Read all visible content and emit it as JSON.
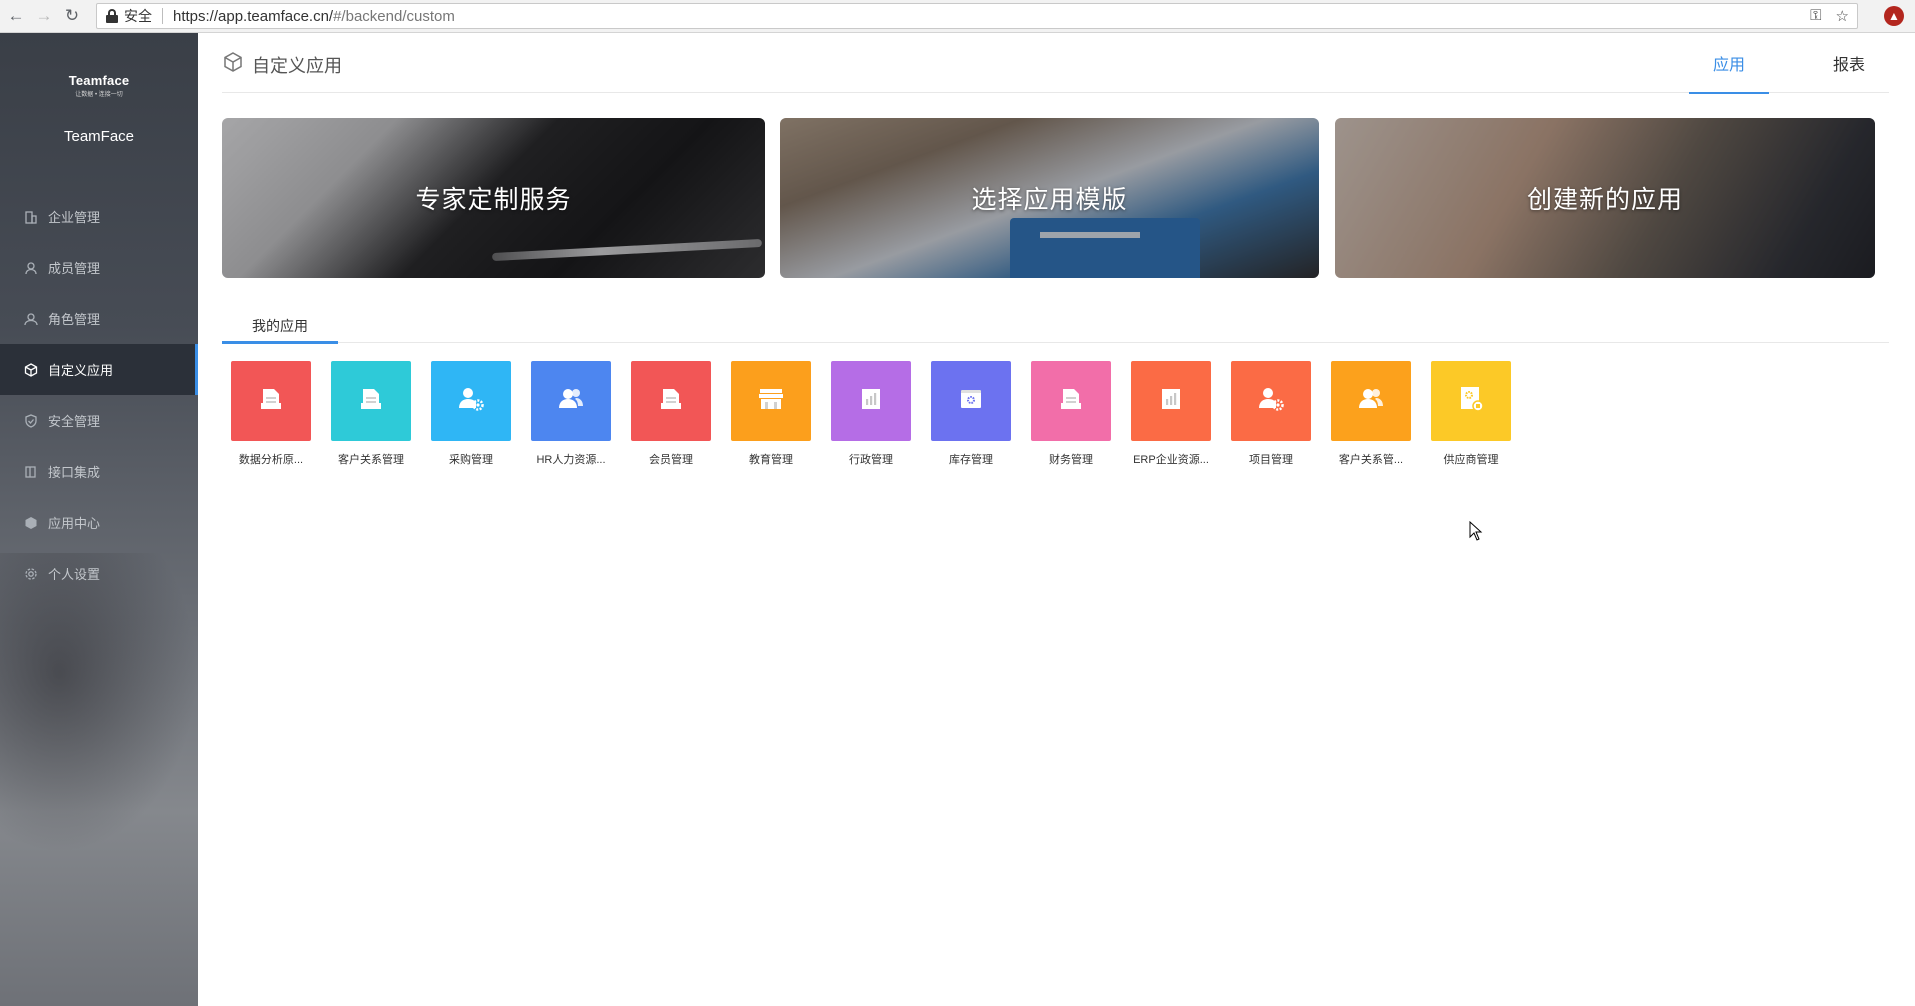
{
  "browser": {
    "secure_label": "安全",
    "url_host": "https://app.teamface.cn/",
    "url_path": "#/backend/custom"
  },
  "sidebar": {
    "logo_name": "Teamface",
    "logo_tagline": "让数据 • 连接一切",
    "company": "TeamFace",
    "items": [
      {
        "label": "企业管理",
        "icon": "building-icon"
      },
      {
        "label": "成员管理",
        "icon": "user-icon"
      },
      {
        "label": "角色管理",
        "icon": "role-icon"
      },
      {
        "label": "自定义应用",
        "icon": "cube-icon",
        "active": true
      },
      {
        "label": "安全管理",
        "icon": "shield-icon"
      },
      {
        "label": "接口集成",
        "icon": "plug-icon"
      },
      {
        "label": "应用中心",
        "icon": "app-center-icon"
      },
      {
        "label": "个人设置",
        "icon": "gear-icon"
      }
    ]
  },
  "header": {
    "title": "自定义应用",
    "tabs": [
      {
        "label": "应用",
        "active": true
      },
      {
        "label": "报表",
        "active": false
      }
    ]
  },
  "banners": [
    {
      "title": "专家定制服务"
    },
    {
      "title": "选择应用模版"
    },
    {
      "title": "创建新的应用"
    }
  ],
  "section_tab": "我的应用",
  "apps": [
    {
      "label": "数据分析原...",
      "color": "#f25656",
      "icon": "form-icon"
    },
    {
      "label": "客户关系管理",
      "color": "#2ecad8",
      "icon": "form-icon"
    },
    {
      "label": "采购管理",
      "color": "#2fb6f5",
      "icon": "user-gear-icon"
    },
    {
      "label": "HR人力资源...",
      "color": "#4d86f0",
      "icon": "users-icon"
    },
    {
      "label": "会员管理",
      "color": "#f25656",
      "icon": "form-icon"
    },
    {
      "label": "教育管理",
      "color": "#fc9f1c",
      "icon": "store-icon"
    },
    {
      "label": "行政管理",
      "color": "#b56de6",
      "icon": "chart-icon"
    },
    {
      "label": "库存管理",
      "color": "#6c72f0",
      "icon": "box-gear-icon"
    },
    {
      "label": "财务管理",
      "color": "#f26ea9",
      "icon": "form-icon"
    },
    {
      "label": "ERP企业资源...",
      "color": "#fb6b45",
      "icon": "chart-icon"
    },
    {
      "label": "项目管理",
      "color": "#fb6b45",
      "icon": "user-gear-icon"
    },
    {
      "label": "客户关系管...",
      "color": "#fca11c",
      "icon": "users-icon"
    },
    {
      "label": "供应商管理",
      "color": "#fcc927",
      "icon": "doc-gear-icon"
    }
  ]
}
